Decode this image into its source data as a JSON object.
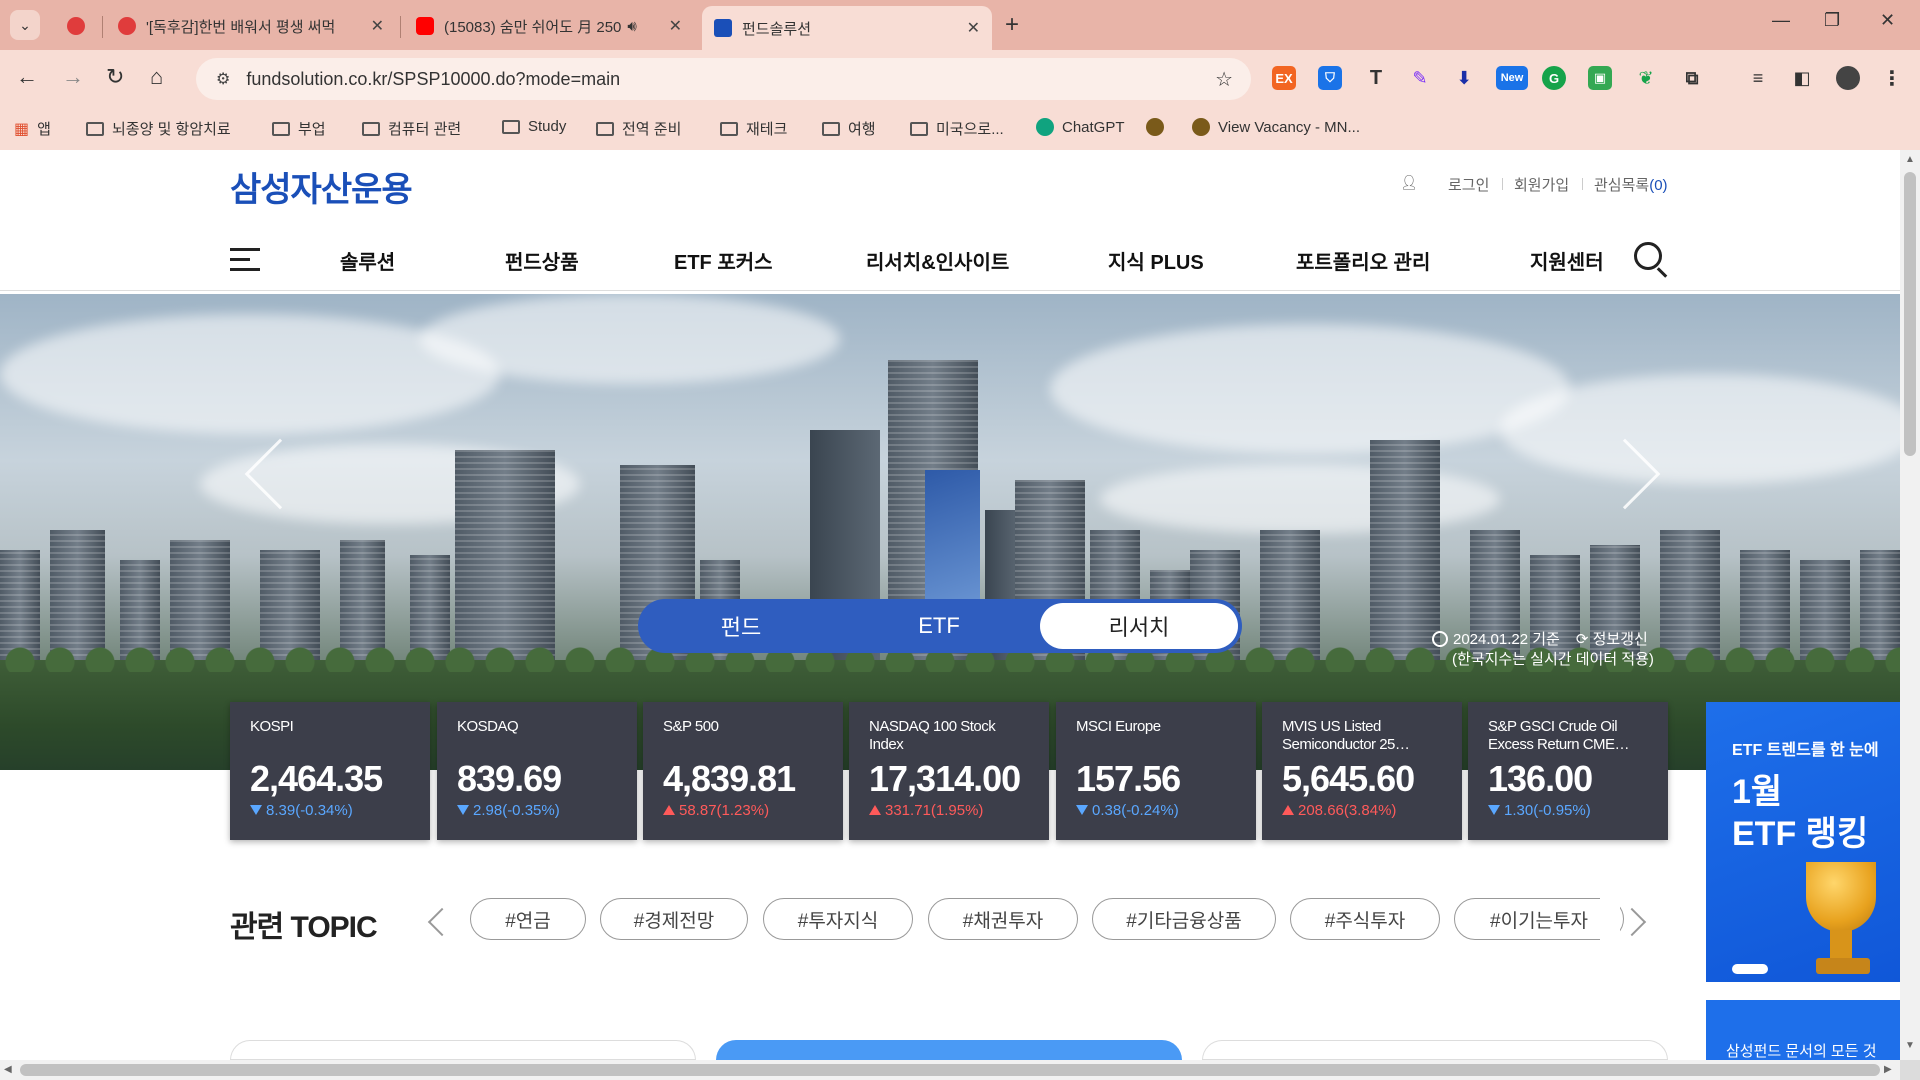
{
  "browser": {
    "tabs": [
      {
        "title": "'[독후감]한번 배워서 평생 써먹",
        "color": "#e03c3c"
      },
      {
        "title": "(15083) 숨만 쉬어도 月 250",
        "color": "#ff0000"
      },
      {
        "title": "펀드솔루션",
        "color": "#1a4fb8"
      }
    ],
    "new_tab": "+",
    "url": "fundsolution.co.kr/SPSP10000.do?mode=main",
    "new_badge": "New",
    "bookmarks": [
      {
        "label": "앱"
      },
      {
        "label": "뇌종양 및 항암치료"
      },
      {
        "label": "부업"
      },
      {
        "label": "컴퓨터 관련"
      },
      {
        "label": "Study"
      },
      {
        "label": "전역 준비"
      },
      {
        "label": "재테크"
      },
      {
        "label": "여행"
      },
      {
        "label": "미국으로..."
      },
      {
        "label": "ChatGPT"
      },
      {
        "label": "View Vacancy - MN..."
      }
    ]
  },
  "site": {
    "logo": "삼성자산운용",
    "util": {
      "login": "로그인",
      "join": "회원가입",
      "wishlist": "관심목록",
      "wishlist_count": "(0)"
    },
    "gnb": [
      "솔루션",
      "펀드상품",
      "ETF 포커스",
      "리서치&인사이트",
      "지식 PLUS",
      "포트폴리오 관리",
      "지원센터"
    ]
  },
  "hero": {
    "tabs": [
      "펀드",
      "ETF",
      "리서치"
    ],
    "active_tab": "리서치",
    "as_of": "2024.01.22 기준",
    "refresh": "정보갱신",
    "note": "(한국지수는 실시간 데이터 적용)"
  },
  "indices": [
    {
      "name": "KOSPI",
      "value": "2,464.35",
      "change": "8.39(-0.34%)",
      "dir": "down"
    },
    {
      "name": "KOSDAQ",
      "value": "839.69",
      "change": "2.98(-0.35%)",
      "dir": "down"
    },
    {
      "name": "S&P 500",
      "value": "4,839.81",
      "change": "58.87(1.23%)",
      "dir": "up"
    },
    {
      "name": "NASDAQ 100 Stock Index",
      "value": "17,314.00",
      "change": "331.71(1.95%)",
      "dir": "up"
    },
    {
      "name": "MSCI Europe",
      "value": "157.56",
      "change": "0.38(-0.24%)",
      "dir": "down"
    },
    {
      "name": "MVIS US Listed Semiconductor 25…",
      "value": "5,645.60",
      "change": "208.66(3.84%)",
      "dir": "up"
    },
    {
      "name": "S&P GSCI Crude Oil Excess Return CME…",
      "value": "136.00",
      "change": "1.30(-0.95%)",
      "dir": "down"
    }
  ],
  "side_banner": {
    "line1": "ETF 트렌드를 한 눈에",
    "line2": "1월",
    "line3": "ETF 랭킹"
  },
  "side_banner2": {
    "text": "삼성펀드 문서의 모든 것"
  },
  "topic": {
    "title": "관련 TOPIC",
    "chips": [
      "#연금",
      "#경제전망",
      "#투자지식",
      "#채권투자",
      "#기타금융상품",
      "#주식투자",
      "#이기는투자"
    ]
  },
  "colors": {
    "brand": "#1a4fb8",
    "card_bg": "#3c3e4a",
    "down": "#5aa7ff",
    "up": "#ff5a5a"
  }
}
